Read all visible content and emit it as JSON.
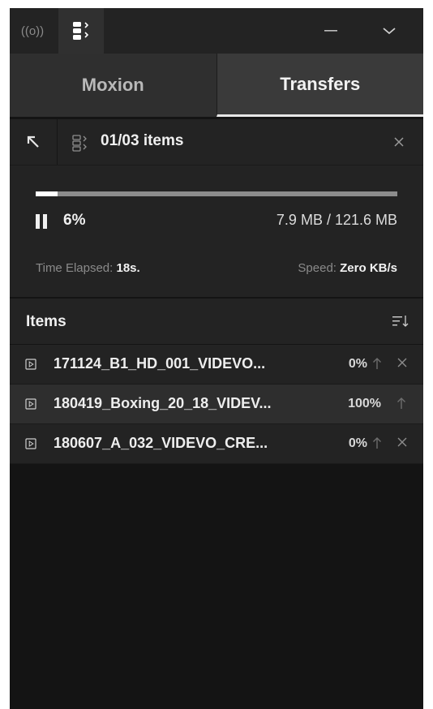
{
  "topbar": {
    "broadcast_icon": "broadcast-icon",
    "transfers_icon": "transfers-icon",
    "minimize_icon": "minimize-icon",
    "collapse_icon": "chevron-down-icon"
  },
  "tabs": [
    {
      "label": "Moxion",
      "active": false
    },
    {
      "label": "Transfers",
      "active": true
    }
  ],
  "queue": {
    "label": "01/03 items",
    "back_icon": "arrow-up-left-icon",
    "close_icon": "close-icon"
  },
  "progress": {
    "fraction": 0.06,
    "percent_label": "6%",
    "size_label": "7.9 MB / 121.6 MB",
    "elapsed_label": "Time Elapsed:",
    "elapsed_value": "18s.",
    "speed_label": "Speed:",
    "speed_value": "Zero KB/s"
  },
  "items_section": {
    "title": "Items",
    "sort_icon": "sort-icon"
  },
  "items": [
    {
      "name": "171124_B1_HD_001_VIDEVO...",
      "percent": "0%",
      "show_close": true
    },
    {
      "name": "180419_Boxing_20_18_VIDEV...",
      "percent": "100%",
      "show_close": false
    },
    {
      "name": "180607_A_032_VIDEVO_CRE...",
      "percent": "0%",
      "show_close": true
    }
  ],
  "colors": {
    "background": "#141414",
    "panel": "#232323",
    "accent": "#ffffff"
  }
}
